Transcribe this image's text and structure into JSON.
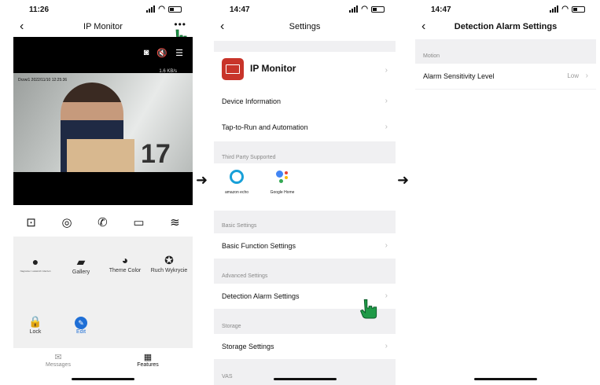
{
  "screen1": {
    "time": "11:26",
    "title": "IP Monitor",
    "more": "•••",
    "kbps": "1.6 KB/s",
    "timestamp": "Drzwi1 2022/11/10 12:25:36",
    "photo_number": "17",
    "features": [
      {
        "label": "Nagrania z ostatnich zdarzeń",
        "icon": "play-icon"
      },
      {
        "label": "Gallery",
        "icon": "gallery-icon"
      },
      {
        "label": "Theme Color",
        "icon": "palette-icon"
      },
      {
        "label": "Ruch Wykrycie",
        "icon": "motion-icon"
      },
      {
        "label": "Lock",
        "icon": "lock-icon"
      },
      {
        "label": "Edit",
        "icon": "edit-icon"
      }
    ],
    "tabs": [
      {
        "label": "Messages",
        "icon": "messages-icon"
      },
      {
        "label": "Features",
        "icon": "features-icon"
      }
    ]
  },
  "screen2": {
    "time": "14:47",
    "title": "Settings",
    "device_name": "IP Monitor",
    "rows": {
      "device_information": "Device Information",
      "tap_to_run": "Tap-to-Run and Automation",
      "basic_function": "Basic Function Settings",
      "detection_alarm": "Detection Alarm Settings",
      "storage_settings": "Storage Settings"
    },
    "sections": {
      "third_party": "Third Party Supported",
      "basic": "Basic Settings",
      "advanced": "Advanced Settings",
      "storage": "Storage",
      "vas": "VAS"
    },
    "third_party": [
      {
        "label": "amazon echo"
      },
      {
        "label": "Google Home"
      }
    ]
  },
  "screen3": {
    "time": "14:47",
    "title": "Detection Alarm Settings",
    "section": "Motion",
    "row_label": "Alarm Sensitivity Level",
    "row_value": "Low"
  },
  "colors": {
    "accent_blue": "#1f6fd6",
    "app_red": "#c8342a",
    "hand_green": "#1e9a47"
  }
}
